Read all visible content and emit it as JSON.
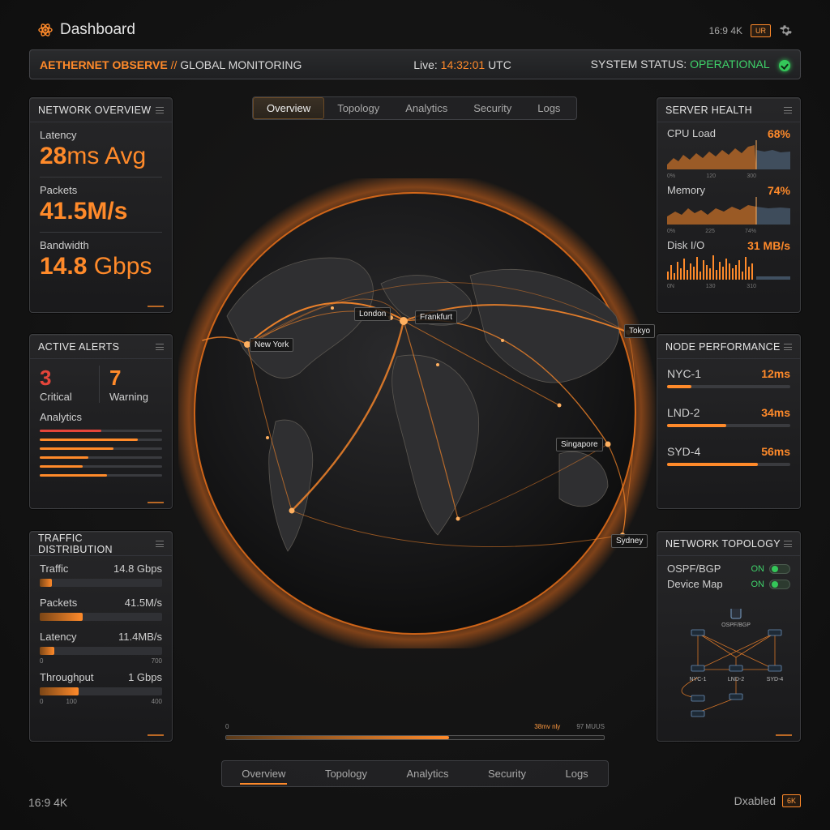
{
  "header": {
    "title": "Dashboard",
    "resolution": "16:9 4K",
    "badge": "UR"
  },
  "status_bar": {
    "brand": "AETHERNET OBSERVE",
    "separator": "//",
    "subtitle": "GLOBAL MONITORING",
    "live_label": "Live:",
    "live_time": "14:32:01",
    "live_zone": "UTC",
    "status_label": "SYSTEM STATUS:",
    "status_value": "OPERATIONAL"
  },
  "tabs_top": [
    "Overview",
    "Topology",
    "Analytics",
    "Security",
    "Logs"
  ],
  "tabs_bottom": [
    "Overview",
    "Topology",
    "Analytics",
    "Security",
    "Logs"
  ],
  "network_overview": {
    "title": "NETWORK OVERVIEW",
    "latency_label": "Latency",
    "latency_num": "28",
    "latency_unit": "ms Avg",
    "packets_label": "Packets",
    "packets_value": "41.5M/s",
    "bandwidth_label": "Bandwidth",
    "bandwidth_num": "14.8",
    "bandwidth_unit": " Gbps"
  },
  "active_alerts": {
    "title": "ACTIVE ALERTS",
    "critical_count": "3",
    "critical_label": "Critical",
    "warning_count": "7",
    "warning_label": "Warning",
    "analytics_label": "Analytics",
    "bars": [
      0.5,
      0.8,
      0.6,
      0.4,
      0.35,
      0.55
    ]
  },
  "traffic_distribution": {
    "title": "TRAFFIC DISTRIBUTION",
    "rows": [
      {
        "label": "Traffic",
        "value": "14.8 Gbps",
        "fill": 0.1
      },
      {
        "label": "Packets",
        "value": "41.5M/s",
        "fill": 0.35
      },
      {
        "label": "Latency",
        "value": "11.4MB/s",
        "fill": 0.12,
        "min": "0",
        "max": "700"
      },
      {
        "label": "Throughput",
        "value": "1 Gbps",
        "fill": 0.32,
        "min": "0",
        "mid": "100",
        "max": "400"
      }
    ]
  },
  "server_health": {
    "title": "SERVER HEALTH",
    "cpu_label": "CPU Load",
    "cpu_value": "68%",
    "cpu_ticks": [
      "0%",
      "120",
      "300"
    ],
    "memory_label": "Memory",
    "memory_value": "74%",
    "memory_ticks": [
      "0%",
      "225",
      "74%"
    ],
    "disk_label": "Disk I/O",
    "disk_value": "31 MB/s",
    "disk_ticks": [
      "0N",
      "130",
      "310"
    ]
  },
  "node_performance": {
    "title": "NODE PERFORMANCE",
    "nodes": [
      {
        "name": "NYC-1",
        "value": "12ms",
        "fill": 0.2
      },
      {
        "name": "LND-2",
        "value": "34ms",
        "fill": 0.48
      },
      {
        "name": "SYD-4",
        "value": "56ms",
        "fill": 0.74
      }
    ]
  },
  "network_topology": {
    "title": "NETWORK TOPOLOGY",
    "rows": [
      {
        "label": "OSPF/BGP",
        "state": "ON"
      },
      {
        "label": "Device Map",
        "state": "ON"
      }
    ],
    "diagram_labels": {
      "core": "OSPF/BGP",
      "n1": "NYC-1",
      "n2": "LND-2",
      "n3": "SYD-4"
    }
  },
  "map_labels": {
    "london": "London",
    "frankfurt": "Frankfurt",
    "new_york": "New York",
    "tokyo": "Tokyo",
    "singapore": "Singapore",
    "sydney": "Sydney"
  },
  "timeline": {
    "start": "0",
    "mid": "38mv nly",
    "end": "97 MUUS",
    "progress": 0.59
  },
  "footer": {
    "left": "16:9 4K",
    "right_label": "Dxabled",
    "right_badge": "6K"
  },
  "colors": {
    "accent": "#ff8a2a",
    "critical": "#e5453a",
    "ok": "#34c759"
  }
}
